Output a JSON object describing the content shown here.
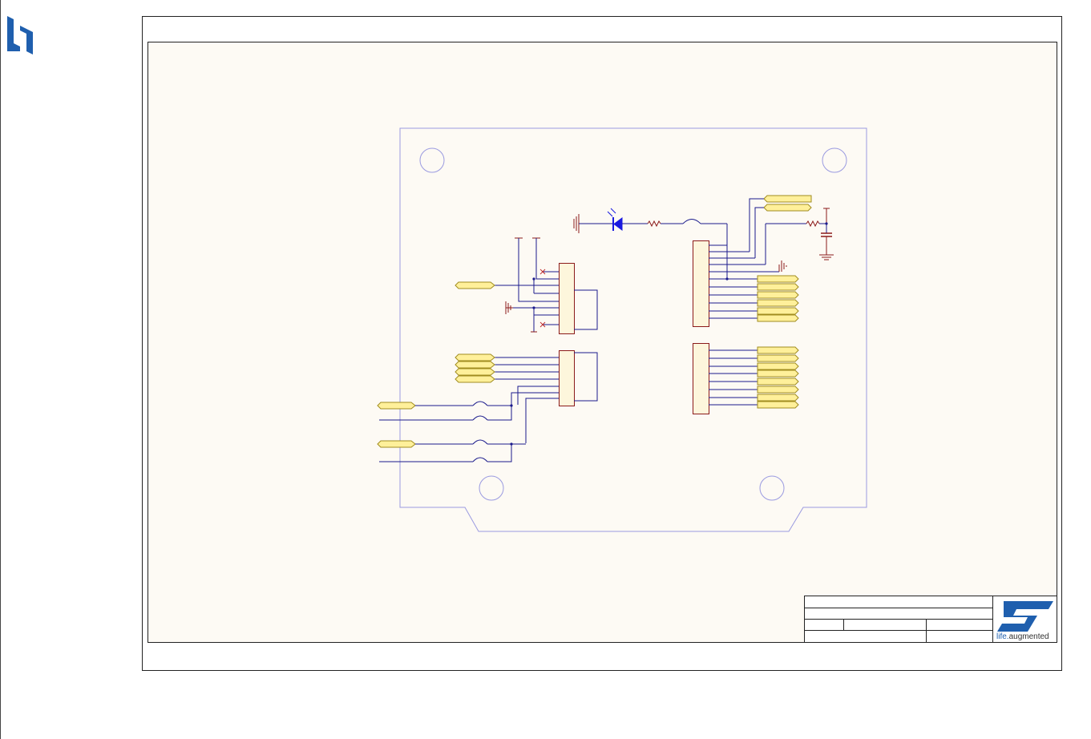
{
  "document": {
    "page_frame": "schematic-sheet",
    "colors": {
      "page_background": "#ffffff",
      "sheet_background": "#fdfaf4",
      "sheet_border": "#222222",
      "board_outline": "#9a9ae0",
      "wire": "#1a1a8c",
      "power_symbol": "#8b1a1a",
      "component_body": "#fdf6dc",
      "component_border": "#8b1a1a",
      "net_port_fill": "#fff09a",
      "net_port_border": "#a08c20",
      "led": "#1a1ae0",
      "st_logo_blue": "#1f5fae"
    }
  },
  "corner_logo": {
    "icon": "st-logo-icon"
  },
  "title_block": {
    "brand_icon": "st-logo-icon",
    "tagline_prefix": "life",
    "tagline_dot": ".",
    "tagline_suffix": "augmented"
  }
}
